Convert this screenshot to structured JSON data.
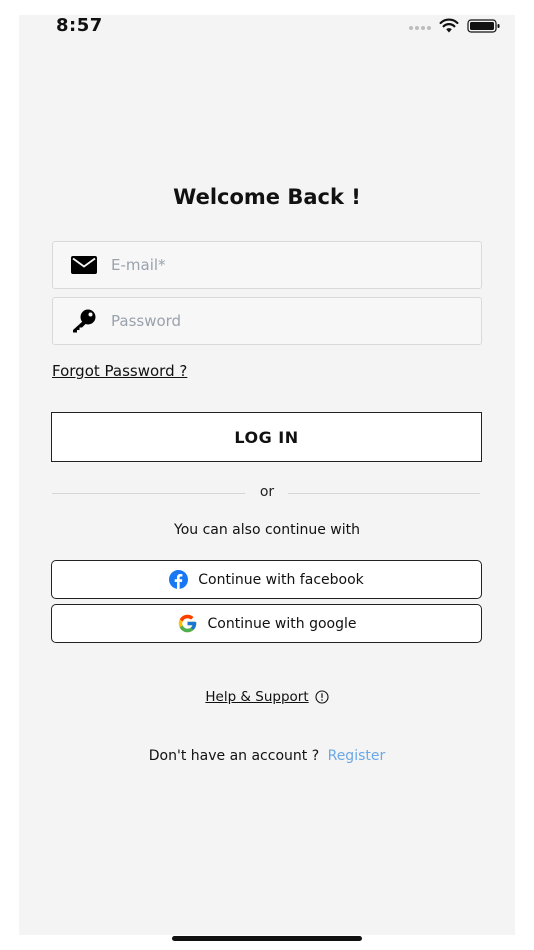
{
  "status_bar": {
    "time": "8:57"
  },
  "title": "Welcome Back !",
  "email": {
    "placeholder": "E-mail*",
    "value": ""
  },
  "password": {
    "placeholder": "Password",
    "value": ""
  },
  "forgot_password": "Forgot Password ?",
  "login_label": "LOG IN",
  "divider_text": "or",
  "continue_text": "You can also continue with",
  "facebook_label": "Continue with facebook",
  "google_label": "Continue with google",
  "help_label": "Help & Support",
  "no_account_text": "Don't have an account ?",
  "register_label": "Register",
  "colors": {
    "accent_link": "#6aa8e6",
    "facebook_blue": "#1877f2",
    "background": "#f4f4f4"
  },
  "icons": [
    "wifi-icon",
    "battery-icon",
    "mail-icon",
    "key-icon",
    "facebook-icon",
    "google-icon",
    "info-icon"
  ]
}
